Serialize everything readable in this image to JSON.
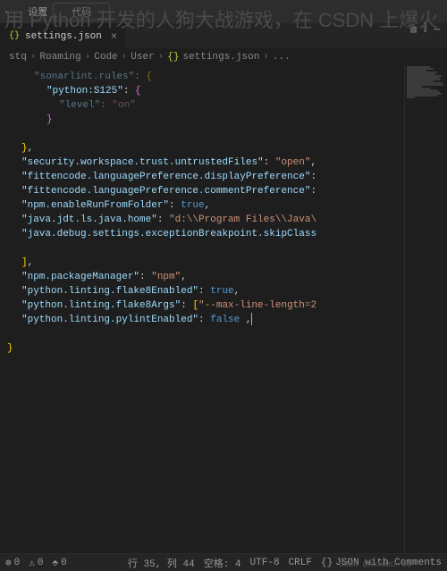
{
  "overlay": {
    "title": "用 Python 开发的人狗大战游戏，在 CSDN 上爆火"
  },
  "titlebar": {
    "left_tab": "设置",
    "search_hint": "代码"
  },
  "tabs": {
    "settings": "settings.json"
  },
  "breadcrumbs": {
    "p1": "stq",
    "p2": "Roaming",
    "p3": "Code",
    "p4": "User",
    "p5": "settings.json",
    "p6": "..."
  },
  "code": {
    "l1_key": "\"sonarlint.rules\"",
    "l2_key": "\"python:S125\"",
    "l3_key": "\"level\"",
    "l3_val": "\"on\"",
    "l6_key": "\"security.workspace.trust.untrustedFiles\"",
    "l6_val": "\"open\"",
    "l7_key": "\"fittencode.languagePreference.displayPreference\"",
    "l8_key": "\"fittencode.languagePreference.commentPreference\"",
    "l9_key": "\"npm.enableRunFromFolder\"",
    "l9_val": "true",
    "l10_key": "\"java.jdt.ls.java.home\"",
    "l10_val": "\"d:\\\\Program Files\\\\Java\\",
    "l11_key": "\"java.debug.settings.exceptionBreakpoint.skipClass",
    "l13_key": "\"npm.packageManager\"",
    "l13_val": "\"npm\"",
    "l14_key": "\"python.linting.flake8Enabled\"",
    "l14_val": "true",
    "l15_key": "\"python.linting.flake8Args\"",
    "l15_val": "\"--max-line-length=2",
    "l16_key": "\"python.linting.pylintEnabled\"",
    "l16_val": "false"
  },
  "statusbar": {
    "errors": "0",
    "warnings": "0",
    "ports": "0",
    "ln_col": "行 35, 列 44",
    "spaces": "空格: 4",
    "encoding": "UTF-8",
    "eol": "CRLF",
    "lang": "JSON with Comments",
    "watermark": "CSDN @xxxmm2.05"
  }
}
